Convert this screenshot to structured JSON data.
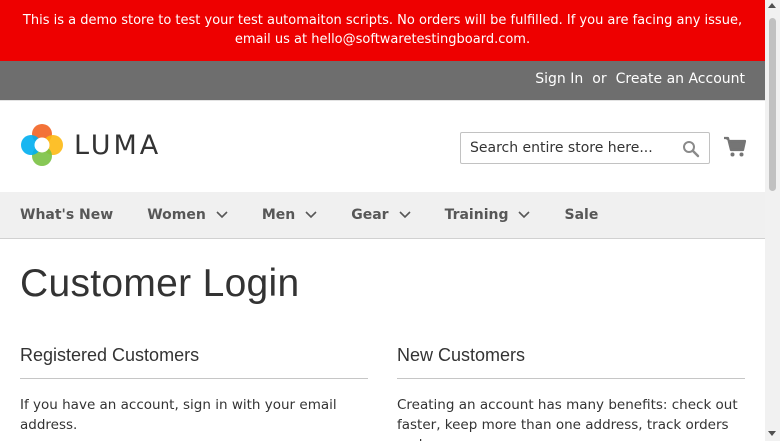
{
  "banner": {
    "text": "This is a demo store to test your test automaiton scripts. No orders will be fulfilled. If you are facing any issue, email us at hello@softwaretestingboard.com."
  },
  "header": {
    "sign_in": "Sign In",
    "or": "or",
    "create_account": "Create an Account"
  },
  "logo": {
    "text": "LUMA",
    "icon": "luma-logo-icon"
  },
  "search": {
    "placeholder": "Search entire store here...",
    "icon": "search-icon"
  },
  "cart": {
    "icon": "cart-icon",
    "label": "My Cart"
  },
  "nav": {
    "items": [
      {
        "label": "What's New",
        "has_dropdown": false
      },
      {
        "label": "Women",
        "has_dropdown": true
      },
      {
        "label": "Men",
        "has_dropdown": true
      },
      {
        "label": "Gear",
        "has_dropdown": true
      },
      {
        "label": "Training",
        "has_dropdown": true
      },
      {
        "label": "Sale",
        "has_dropdown": false
      }
    ]
  },
  "page": {
    "title": "Customer Login",
    "registered": {
      "title": "Registered Customers",
      "text": "If you have an account, sign in with your email address."
    },
    "new_customers": {
      "title": "New Customers",
      "text": "Creating an account has many benefits: check out faster, keep more than one address, track orders and"
    }
  },
  "colors": {
    "banner_bg": "#ee0000",
    "header_bg": "#6e6e6e",
    "nav_bg": "#f0f0f0",
    "text": "#333333"
  }
}
